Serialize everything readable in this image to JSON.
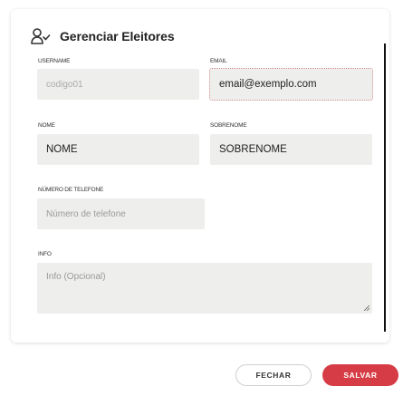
{
  "dialog": {
    "title": "Gerenciar Eleitores",
    "icon": "user-check-icon"
  },
  "form": {
    "username": {
      "label": "USERNAME",
      "value": "codigo01"
    },
    "email": {
      "label": "EMAIL",
      "value": "email@exemplo.com"
    },
    "nome": {
      "label": "NOME",
      "value": "NOME"
    },
    "sobrenome": {
      "label": "SOBRENOME",
      "value": "SOBRENOME"
    },
    "telefone": {
      "label": "NÚMERO DE TELEFONE",
      "placeholder": "Número de telefone"
    },
    "info": {
      "label": "INFO",
      "placeholder": "Info (Opcional)"
    }
  },
  "actions": {
    "cancel_label": "FECHAR",
    "save_label": "SALVAR"
  },
  "colors": {
    "accent": "#d63c45",
    "field_bg": "#eeeeec"
  }
}
